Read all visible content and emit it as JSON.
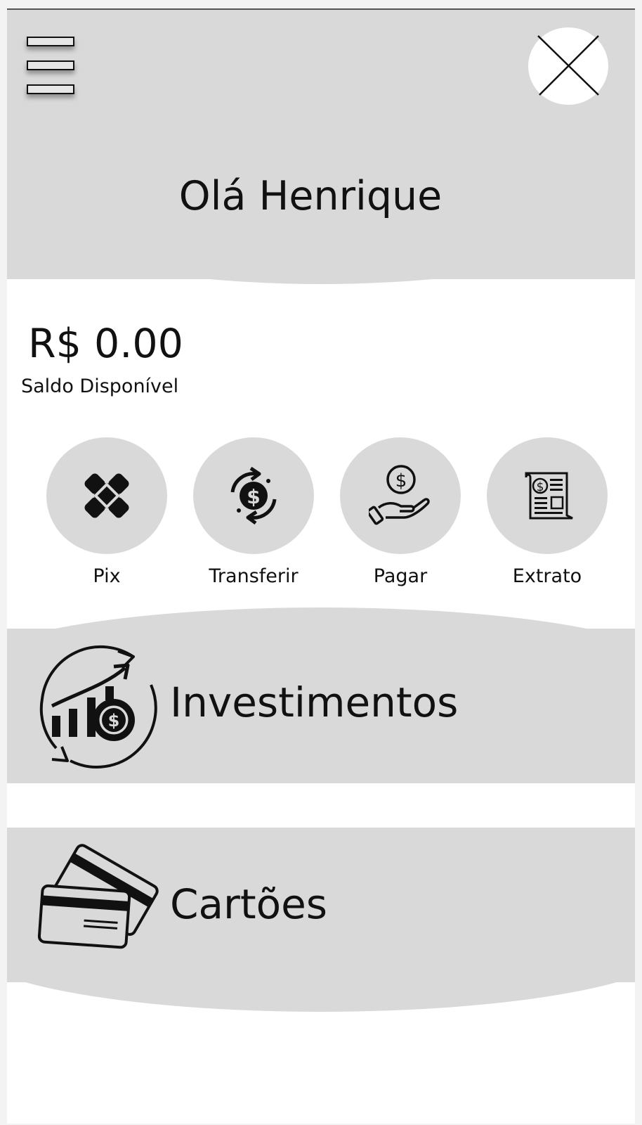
{
  "header": {
    "greeting": "Olá Henrique"
  },
  "account": {
    "balance": "R$ 0.00",
    "balance_label": "Saldo Disponível"
  },
  "actions": [
    {
      "label": "Pix",
      "icon": "pix-icon"
    },
    {
      "label": "Transferir",
      "icon": "transfer-money-icon"
    },
    {
      "label": "Pagar",
      "icon": "hand-coin-icon"
    },
    {
      "label": "Extrato",
      "icon": "statement-receipt-icon"
    }
  ],
  "sections": {
    "investments": {
      "label": "Investimentos",
      "icon": "investment-growth-icon"
    },
    "cards": {
      "label": "Cartões",
      "icon": "credit-cards-icon"
    }
  },
  "colors": {
    "panel": "#d9d9d9",
    "background": "#ffffff",
    "ink": "#111111"
  }
}
